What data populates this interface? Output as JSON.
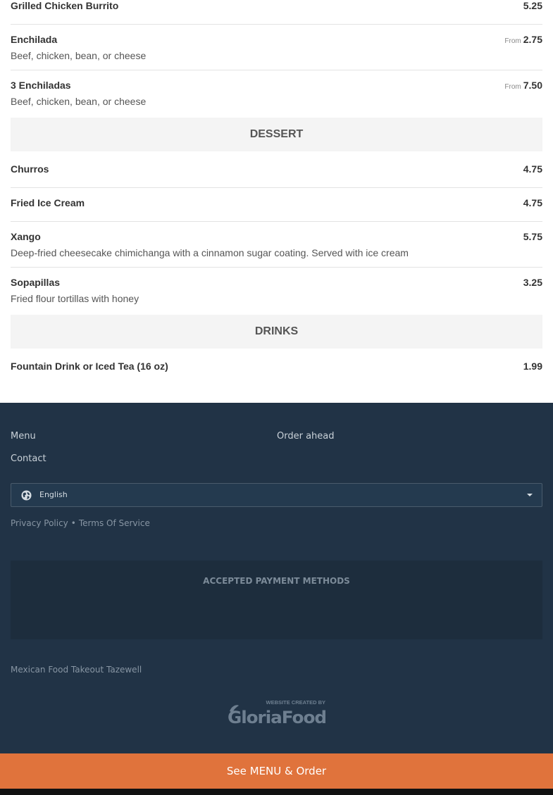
{
  "menu": {
    "burrito": {
      "name": "Grilled Chicken Burrito",
      "price": "5.25"
    },
    "enchilada": {
      "name": "Enchilada",
      "desc": "Beef, chicken, bean, or cheese",
      "from": "From",
      "price": "2.75"
    },
    "enchiladas3": {
      "name": "3 Enchiladas",
      "desc": "Beef, chicken, bean, or cheese",
      "from": "From",
      "price": "7.50"
    },
    "dessert_title": "DESSERT",
    "churros": {
      "name": "Churros",
      "price": "4.75"
    },
    "fried_ice_cream": {
      "name": "Fried Ice Cream",
      "price": "4.75"
    },
    "xango": {
      "name": "Xango",
      "desc": "Deep-fried cheesecake chimichanga with a cinnamon sugar coating. Served with ice cream",
      "price": "5.75"
    },
    "sopapillas": {
      "name": "Sopapillas",
      "desc": "Fried flour tortillas with honey",
      "price": "3.25"
    },
    "drinks_title": "DRINKS",
    "fountain": {
      "name": "Fountain Drink or Iced Tea (16 oz)",
      "price": "1.99"
    }
  },
  "footer": {
    "nav_menu": "Menu",
    "nav_order_ahead": "Order ahead",
    "nav_contact": "Contact",
    "language": "English",
    "privacy_policy": "Privacy Policy",
    "legal_separator": "•",
    "terms_of_service": "Terms Of Service",
    "payment_title": "ACCEPTED PAYMENT METHODS",
    "takeout_link": "Mexican Food Takeout Tazewell",
    "credit_top": "WEBSITE CREATED BY",
    "credit_brand": "GloriaFood"
  },
  "order_button": "See MENU & Order",
  "colors": {
    "footer_bg": "#213346",
    "order_bar": "#e0733c",
    "section_header_bg": "#f4f4f4"
  },
  "icons": {
    "language": "globe-icon",
    "select": "caret-down-icon"
  }
}
